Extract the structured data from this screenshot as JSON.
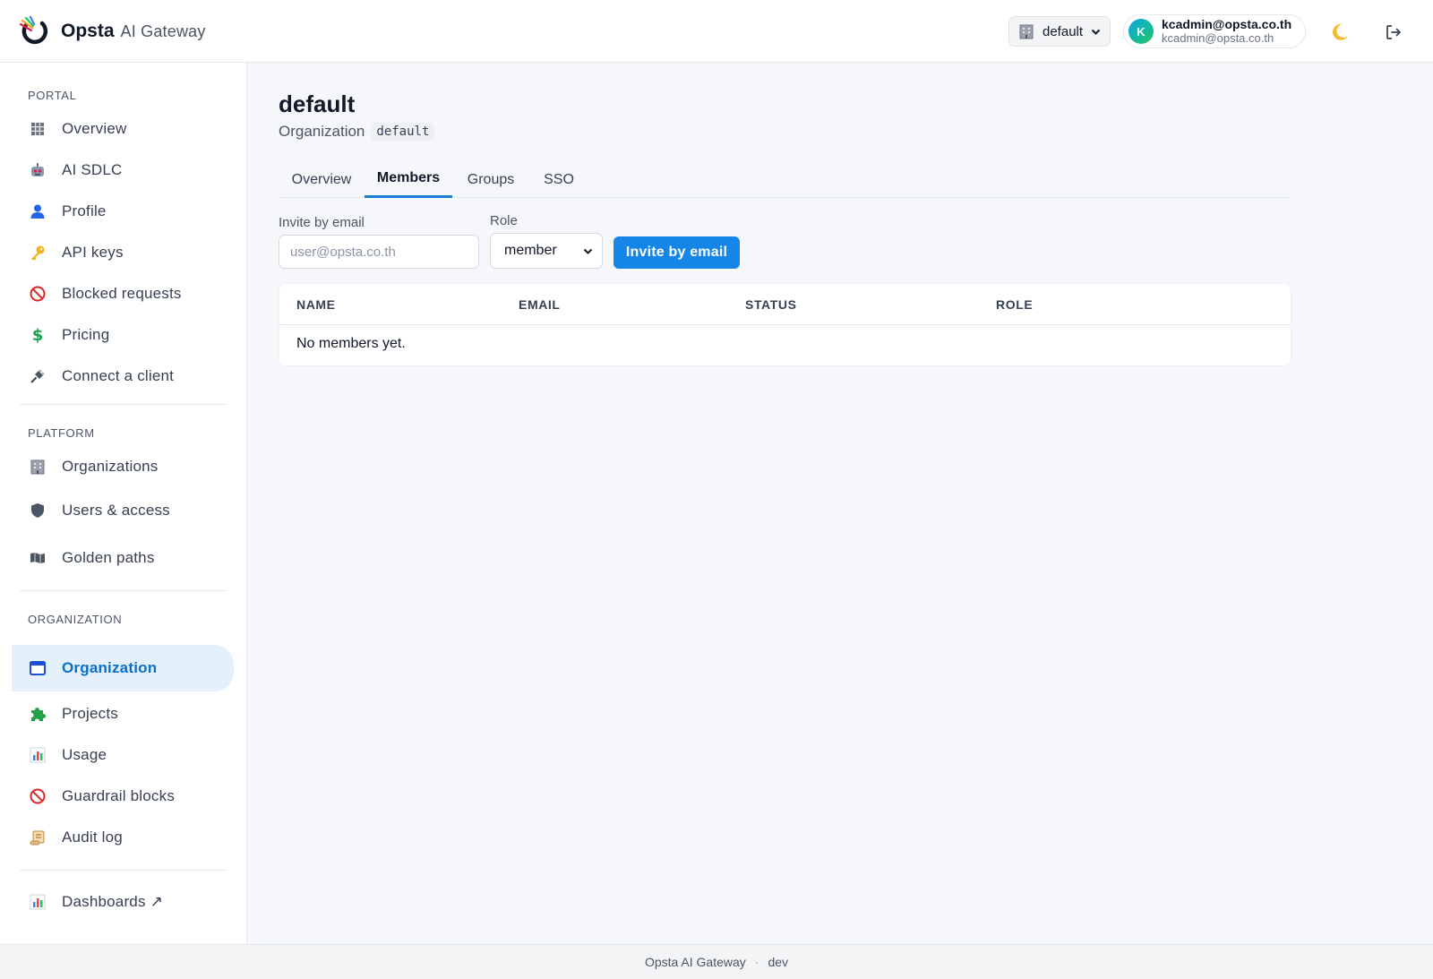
{
  "app": {
    "brand_name": "Opsta",
    "brand_sub": "AI Gateway"
  },
  "header": {
    "org_selector": {
      "value": "default",
      "icon": "building-icon"
    },
    "user": {
      "initial": "K",
      "name": "kcadmin@opsta.co.th",
      "email": "kcadmin@opsta.co.th"
    },
    "theme_icon": "moon-icon",
    "logout_icon": "logout-icon"
  },
  "sidebar": {
    "portal_label": "PORTAL",
    "portal_items": [
      {
        "label": "Overview",
        "icon": "grid-icon"
      },
      {
        "label": "AI SDLC",
        "icon": "robot-icon"
      },
      {
        "label": "Profile",
        "icon": "user-icon"
      },
      {
        "label": "API keys",
        "icon": "key-icon"
      },
      {
        "label": "Blocked requests",
        "icon": "prohibited-icon"
      },
      {
        "label": "Pricing",
        "icon": "dollar-icon"
      },
      {
        "label": "Connect a client",
        "icon": "plug-icon"
      }
    ],
    "platform_label": "PLATFORM",
    "platform_items": [
      {
        "label": "Organizations",
        "icon": "building-icon"
      },
      {
        "label": "Users & access",
        "icon": "shield-icon"
      },
      {
        "label": "Golden paths",
        "icon": "map-icon"
      }
    ],
    "organization_label": "ORGANIZATION",
    "organization_items": [
      {
        "label": "Organization",
        "icon": "window-icon",
        "active": true
      },
      {
        "label": "Projects",
        "icon": "puzzle-icon"
      },
      {
        "label": "Usage",
        "icon": "bar-chart-icon"
      },
      {
        "label": "Guardrail blocks",
        "icon": "prohibited-icon"
      },
      {
        "label": "Audit log",
        "icon": "scroll-icon"
      }
    ],
    "dashboards": {
      "label": "Dashboards ↗",
      "icon": "bar-chart-icon"
    }
  },
  "page": {
    "title": "default",
    "subtitle": "Organization",
    "org_code": "default",
    "tabs": [
      "Overview",
      "Members",
      "Groups",
      "SSO"
    ],
    "active_tab": "Members"
  },
  "invite_form": {
    "email_label": "Invite by email",
    "email_placeholder": "user@opsta.co.th",
    "role_label": "Role",
    "role_value": "member",
    "submit_label": "Invite by email"
  },
  "members_table": {
    "columns": [
      "NAME",
      "EMAIL",
      "STATUS",
      "ROLE"
    ],
    "empty_message": "No members yet."
  },
  "footer": {
    "app_name": "Opsta AI Gateway",
    "separator": "·",
    "env": "dev"
  },
  "colors": {
    "accent": "#1685e8",
    "active_bg": "#e4f0fb",
    "active_text": "#0b6fc7",
    "page_bg": "#f5f7fb"
  }
}
